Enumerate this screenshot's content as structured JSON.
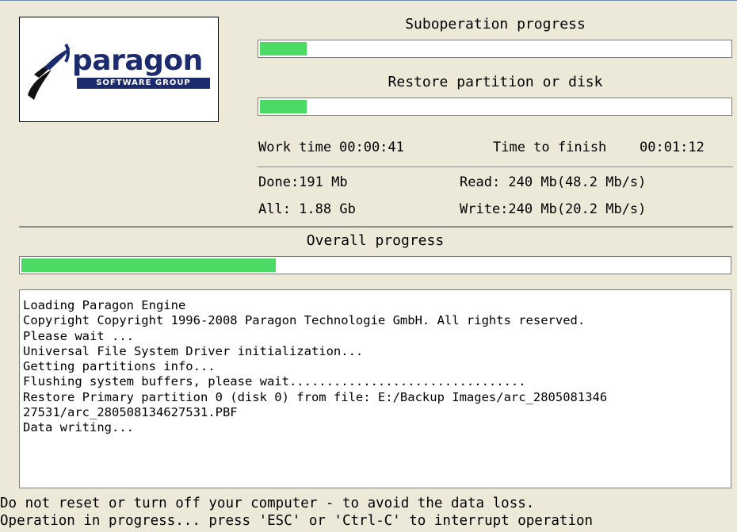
{
  "logo": {
    "brand": "paragon",
    "subtitle": "SOFTWARE GROUP"
  },
  "suboperation": {
    "label": "Suboperation progress",
    "progress": 0.1
  },
  "restore": {
    "label": "Restore partition or disk",
    "progress": 0.1
  },
  "timing": {
    "work_time_label": "Work time",
    "work_time_value": "00:00:41",
    "time_to_finish_label": "Time to finish",
    "time_to_finish_value": "00:01:12"
  },
  "stats": {
    "done": "Done:191 Mb",
    "all": "All: 1.88 Gb",
    "read": "Read: 240 Mb(48.2 Mb/s)",
    "write": "Write:240 Mb(20.2 Mb/s)"
  },
  "overall": {
    "label": "Overall progress",
    "progress": 0.36
  },
  "log_lines": [
    "Loading Paragon Engine",
    "Copyright Copyright 1996-2008 Paragon Technologie GmbH. All rights reserved.",
    "Please wait ...",
    "Universal File System Driver initialization...",
    "Getting partitions info...",
    "Flushing system buffers, please wait................................",
    "Restore Primary partition 0 (disk 0) from file: E:/Backup Images/arc_2805081346",
    "27531/arc_280508134627531.PBF",
    "Data writing..."
  ],
  "footer": {
    "warning": "Do not reset or turn off your computer - to avoid the data loss.",
    "status": "Operation in progress... press 'ESC' or 'Ctrl-C' to interrupt operation"
  },
  "colors": {
    "progress_fill": "#4cd964",
    "background": "#ece9d8",
    "logo_navy": "#1c2a6e"
  }
}
